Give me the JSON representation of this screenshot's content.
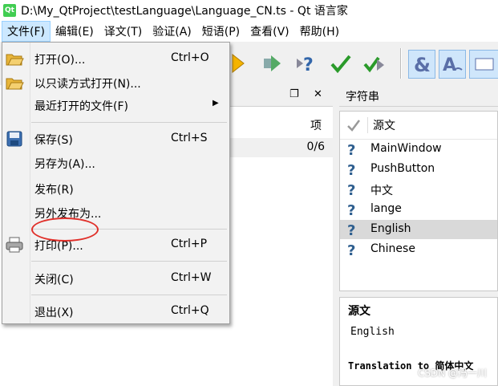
{
  "window": {
    "title": "D:\\My_QtProject\\testLanguage\\Language_CN.ts - Qt 语言家",
    "app_icon": "Qt"
  },
  "menubar": [
    "文件(F)",
    "编辑(E)",
    "译文(T)",
    "验证(A)",
    "短语(P)",
    "查看(V)",
    "帮助(H)"
  ],
  "file_menu": [
    {
      "label": "打开(O)...",
      "shortcut": "Ctrl+O"
    },
    {
      "label": "以只读方式打开(N)...",
      "shortcut": ""
    },
    {
      "label": "最近打开的文件(F)",
      "shortcut": ""
    },
    {
      "label": "保存(S)",
      "shortcut": "Ctrl+S"
    },
    {
      "label": "另存为(A)...",
      "shortcut": ""
    },
    {
      "label": "发布(R)",
      "shortcut": ""
    },
    {
      "label": "另外发布为...",
      "shortcut": ""
    },
    {
      "label": "打印(P)...",
      "shortcut": "Ctrl+P"
    },
    {
      "label": "关闭(C)",
      "shortcut": "Ctrl+W"
    },
    {
      "label": "退出(X)",
      "shortcut": "Ctrl+Q"
    }
  ],
  "context_dock": {
    "column_header": "项",
    "row_count": "0/6"
  },
  "strings_dock": {
    "title": "字符串",
    "column_header": "源文",
    "items": [
      "MainWindow",
      "PushButton",
      "中文",
      "lange",
      "English",
      "Chinese"
    ],
    "selected": "English"
  },
  "source_panel": {
    "title": "源文",
    "text": "English",
    "translation_label": "Translation to 简体中文"
  },
  "watermark": "CSDN @冯一川",
  "colors": {
    "menu_highlight": "#cce8ff",
    "annotation_circle": "#e0302a",
    "selected_row": "#d9d9d9"
  }
}
